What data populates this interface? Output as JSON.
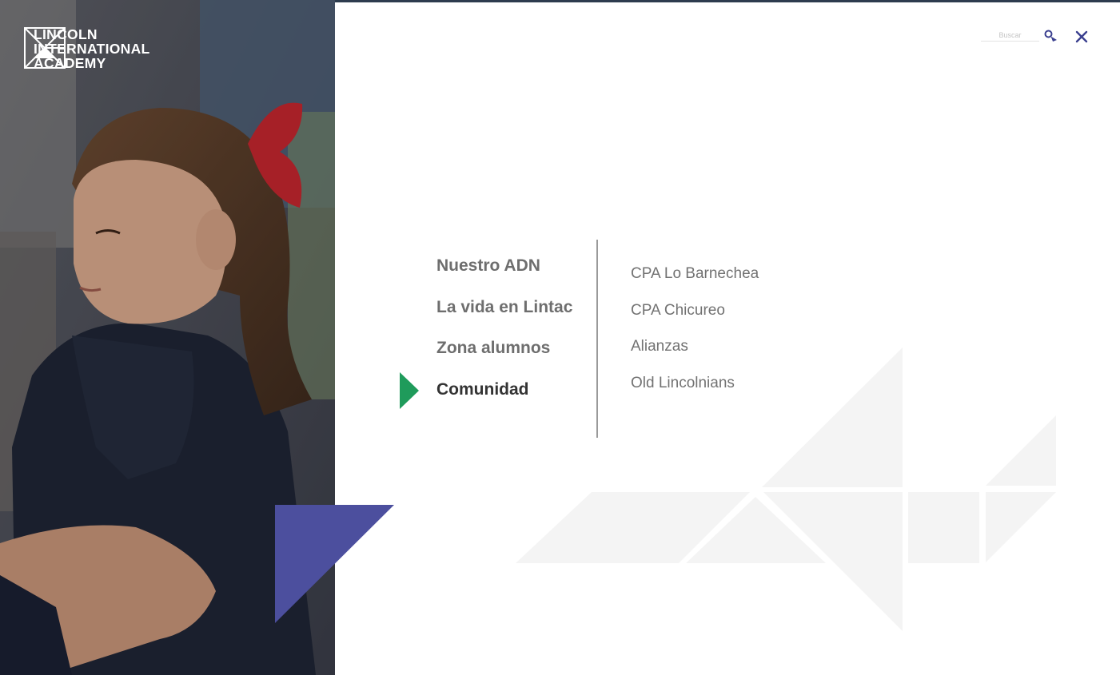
{
  "brand": {
    "logo_lines": [
      "LINCOLN",
      "INTERNATIONAL",
      "ACADEMY"
    ]
  },
  "search": {
    "placeholder": "Buscar",
    "icon": "search-icon"
  },
  "close": {
    "icon": "close-icon"
  },
  "main_menu": [
    {
      "label": "Nuestro ADN",
      "active": false
    },
    {
      "label": "La vida en Lintac",
      "active": false
    },
    {
      "label": "Zona alumnos",
      "active": false
    },
    {
      "label": "Comunidad",
      "active": true
    }
  ],
  "sub_menu": [
    {
      "label": "CPA Lo Barnechea"
    },
    {
      "label": "CPA Chicureo"
    },
    {
      "label": "Alianzas"
    },
    {
      "label": "Old Lincolnians"
    }
  ],
  "colors": {
    "accent_green": "#1f9b5b",
    "accent_purple": "#4c4f9e",
    "text_dark": "#333333",
    "text_muted": "#6e6e6e",
    "deco_gray": "#f4f4f4",
    "close_blue": "#3a3f8f"
  }
}
